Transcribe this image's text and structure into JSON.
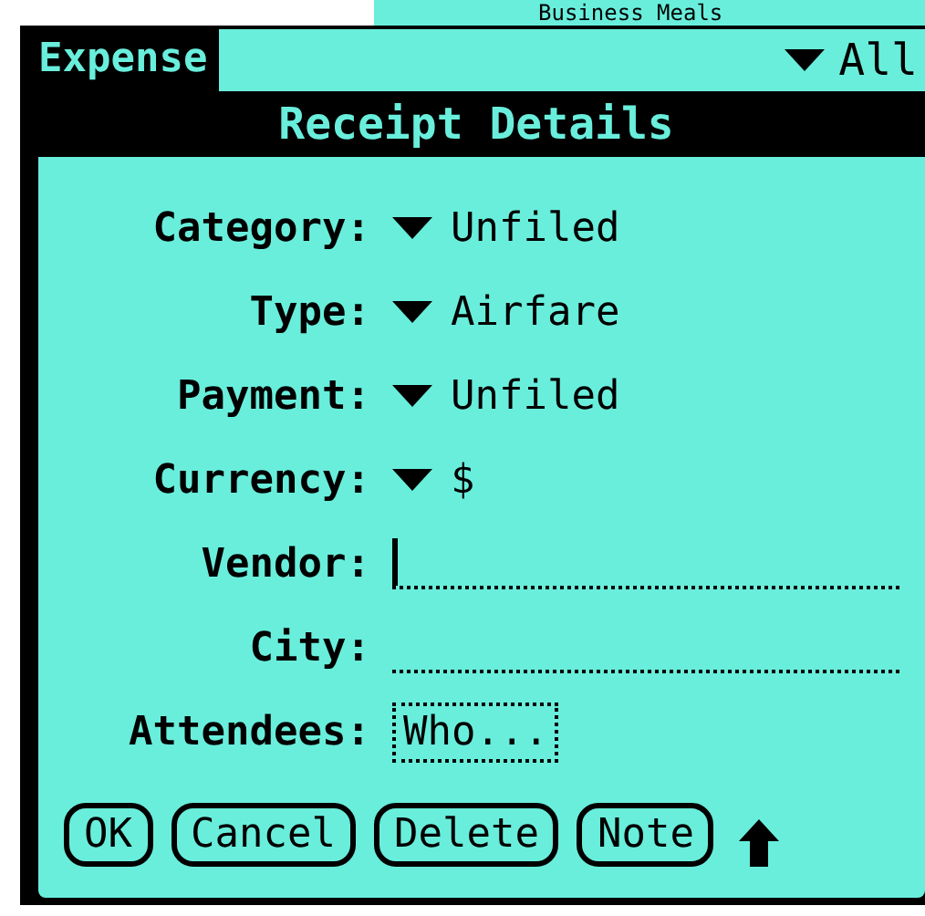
{
  "background_list": {
    "visible_item": "Business Meals"
  },
  "app_tab": {
    "label": "Expense"
  },
  "category_filter": {
    "value": "All"
  },
  "dialog": {
    "title": "Receipt Details",
    "fields": [
      {
        "label": "Category:",
        "kind": "dropdown",
        "value": "Unfiled"
      },
      {
        "label": "Type:",
        "kind": "dropdown",
        "value": "Airfare"
      },
      {
        "label": "Payment:",
        "kind": "dropdown",
        "value": "Unfiled"
      },
      {
        "label": "Currency:",
        "kind": "dropdown",
        "value": "$"
      },
      {
        "label": "Vendor:",
        "kind": "text",
        "focused": true
      },
      {
        "label": "City:",
        "kind": "text",
        "focused": false
      },
      {
        "label": "Attendees:",
        "kind": "picker",
        "value": "Who..."
      }
    ],
    "buttons": [
      "OK",
      "Cancel",
      "Delete",
      "Note"
    ]
  }
}
